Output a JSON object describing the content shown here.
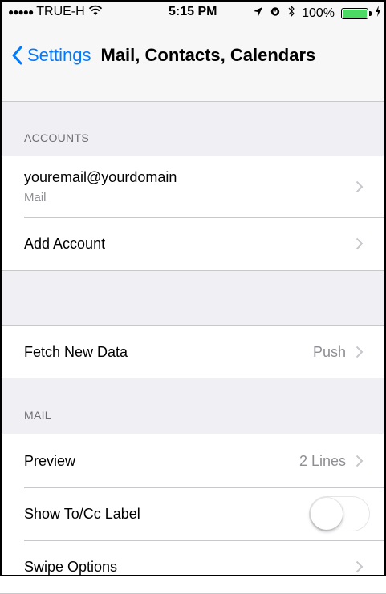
{
  "status_bar": {
    "signal_dots": "●●●●●",
    "carrier": "TRUE-H",
    "time": "5:15 PM",
    "battery_percent": "100%",
    "battery_level": 1.0,
    "icons": [
      "wifi-icon",
      "location-arrow-icon",
      "alarm-icon",
      "bluetooth-icon",
      "battery-icon",
      "charging-icon"
    ]
  },
  "nav": {
    "back_label": "Settings",
    "title": "Mail, Contacts, Calendars"
  },
  "sections": {
    "accounts_header": "ACCOUNTS",
    "mail_header": "MAIL"
  },
  "accounts": [
    {
      "title": "youremail@yourdomain",
      "subtitle": "Mail"
    },
    {
      "title": "Add Account"
    }
  ],
  "fetch": {
    "label": "Fetch New Data",
    "value": "Push"
  },
  "mail_settings": {
    "preview": {
      "label": "Preview",
      "value": "2 Lines"
    },
    "show_to_cc": {
      "label": "Show To/Cc Label",
      "enabled": false
    },
    "swipe_options": {
      "label": "Swipe Options"
    }
  },
  "colors": {
    "accent": "#007aff",
    "background": "#efeff4",
    "battery": "#4cd964"
  }
}
